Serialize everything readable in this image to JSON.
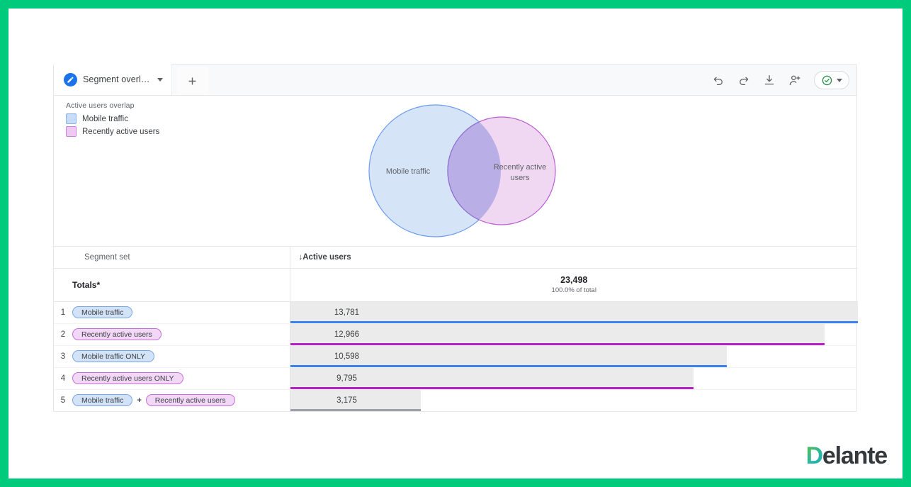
{
  "frame": {
    "accent_color": "#00cb7c"
  },
  "tabs": {
    "active": {
      "label": "Segment overl…",
      "icon": "pencil-icon",
      "caret": "chevron-down-icon"
    },
    "add_label": "+"
  },
  "toolbar": {
    "icons": [
      "undo-icon",
      "redo-icon",
      "download-icon",
      "share-add-user-icon"
    ],
    "status": {
      "icon": "check-circle-icon",
      "color": "#1e8e3e",
      "caret": "chevron-down-icon"
    }
  },
  "venn": {
    "legend_title": "Active users overlap",
    "items": [
      {
        "label": "Mobile traffic",
        "color": "#c7dcf7",
        "border": "#8bb4e8"
      },
      {
        "label": "Recently active users",
        "color": "#eec9f1",
        "border": "#cc7fdc"
      }
    ],
    "left_label": "Mobile traffic",
    "right_label_line1": "Recently active",
    "right_label_line2": "users"
  },
  "table": {
    "headers": {
      "segment": "Segment set",
      "metric_arrow": "↓",
      "metric": "Active users"
    },
    "totals": {
      "label": "Totals*",
      "value": "23,498",
      "percent": "100.0% of total"
    },
    "rows": [
      {
        "index": "1",
        "chips": [
          {
            "label": "Mobile traffic",
            "style": "blue"
          }
        ],
        "value": "13,781",
        "bar_pct": 100,
        "line_color": "blue"
      },
      {
        "index": "2",
        "chips": [
          {
            "label": "Recently active users",
            "style": "purple"
          }
        ],
        "value": "12,966",
        "bar_pct": 94.1,
        "line_color": "purple"
      },
      {
        "index": "3",
        "chips": [
          {
            "label": "Mobile traffic ONLY",
            "style": "blue"
          }
        ],
        "value": "10,598",
        "bar_pct": 76.9,
        "line_color": "blue"
      },
      {
        "index": "4",
        "chips": [
          {
            "label": "Recently active users ONLY",
            "style": "purple"
          }
        ],
        "value": "9,795",
        "bar_pct": 71.1,
        "line_color": "purple"
      },
      {
        "index": "5",
        "chips": [
          {
            "label": "Mobile traffic",
            "style": "blue"
          },
          {
            "label": "+",
            "style": "plus"
          },
          {
            "label": "Recently active users",
            "style": "purple"
          }
        ],
        "value": "3,175",
        "bar_pct": 23.0,
        "line_color": "gray"
      }
    ]
  },
  "logo": {
    "first": "D",
    "rest": "elante"
  },
  "chart_data": {
    "type": "bar",
    "title": "Active users overlap",
    "xlabel": "",
    "ylabel": "Active users",
    "categories": [
      "Mobile traffic",
      "Recently active users",
      "Mobile traffic ONLY",
      "Recently active users ONLY",
      "Mobile traffic + Recently active users"
    ],
    "values": [
      13781,
      12966,
      10598,
      9795,
      3175
    ],
    "total": 23498,
    "total_percent": "100.0% of total",
    "xlim": [
      0,
      13781
    ],
    "grid": false,
    "legend": [
      "Mobile traffic",
      "Recently active users"
    ],
    "venn": {
      "set_a": {
        "name": "Mobile traffic",
        "total": 13781,
        "only": 10598,
        "color": "#c7dcf7"
      },
      "set_b": {
        "name": "Recently active users",
        "total": 12966,
        "only": 9795,
        "color": "#eec9f1"
      },
      "intersection": 3175
    }
  }
}
